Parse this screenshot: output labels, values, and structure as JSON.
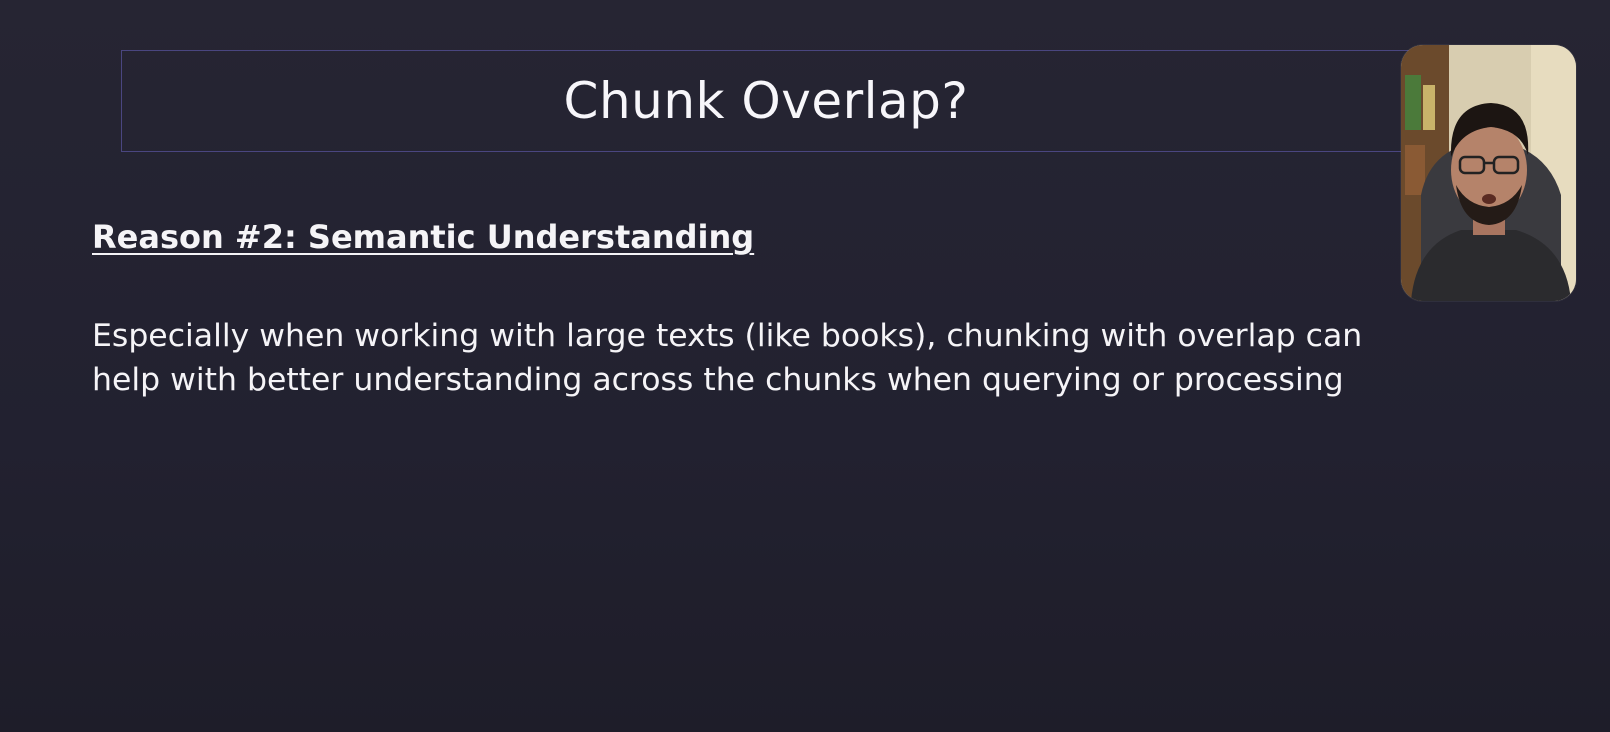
{
  "slide": {
    "title": "Chunk Overlap?",
    "subheading": "Reason #2: Semantic Understanding",
    "body_lines": [
      "Especially when working with large texts (like books), chunking with overlap can",
      "help with better understanding across the chunks when querying or processing"
    ]
  },
  "webcam": {
    "icon": "presenter-video-feed",
    "colors": {
      "wall": "#d8cdb0",
      "shelf": "#6b4a2c",
      "skin": "#b5836a",
      "hair": "#1c1512",
      "shirt": "#2b2b2e"
    }
  },
  "theme": {
    "background": "#232230",
    "title_border": "#4a4680",
    "text": "#f5f4f7"
  }
}
